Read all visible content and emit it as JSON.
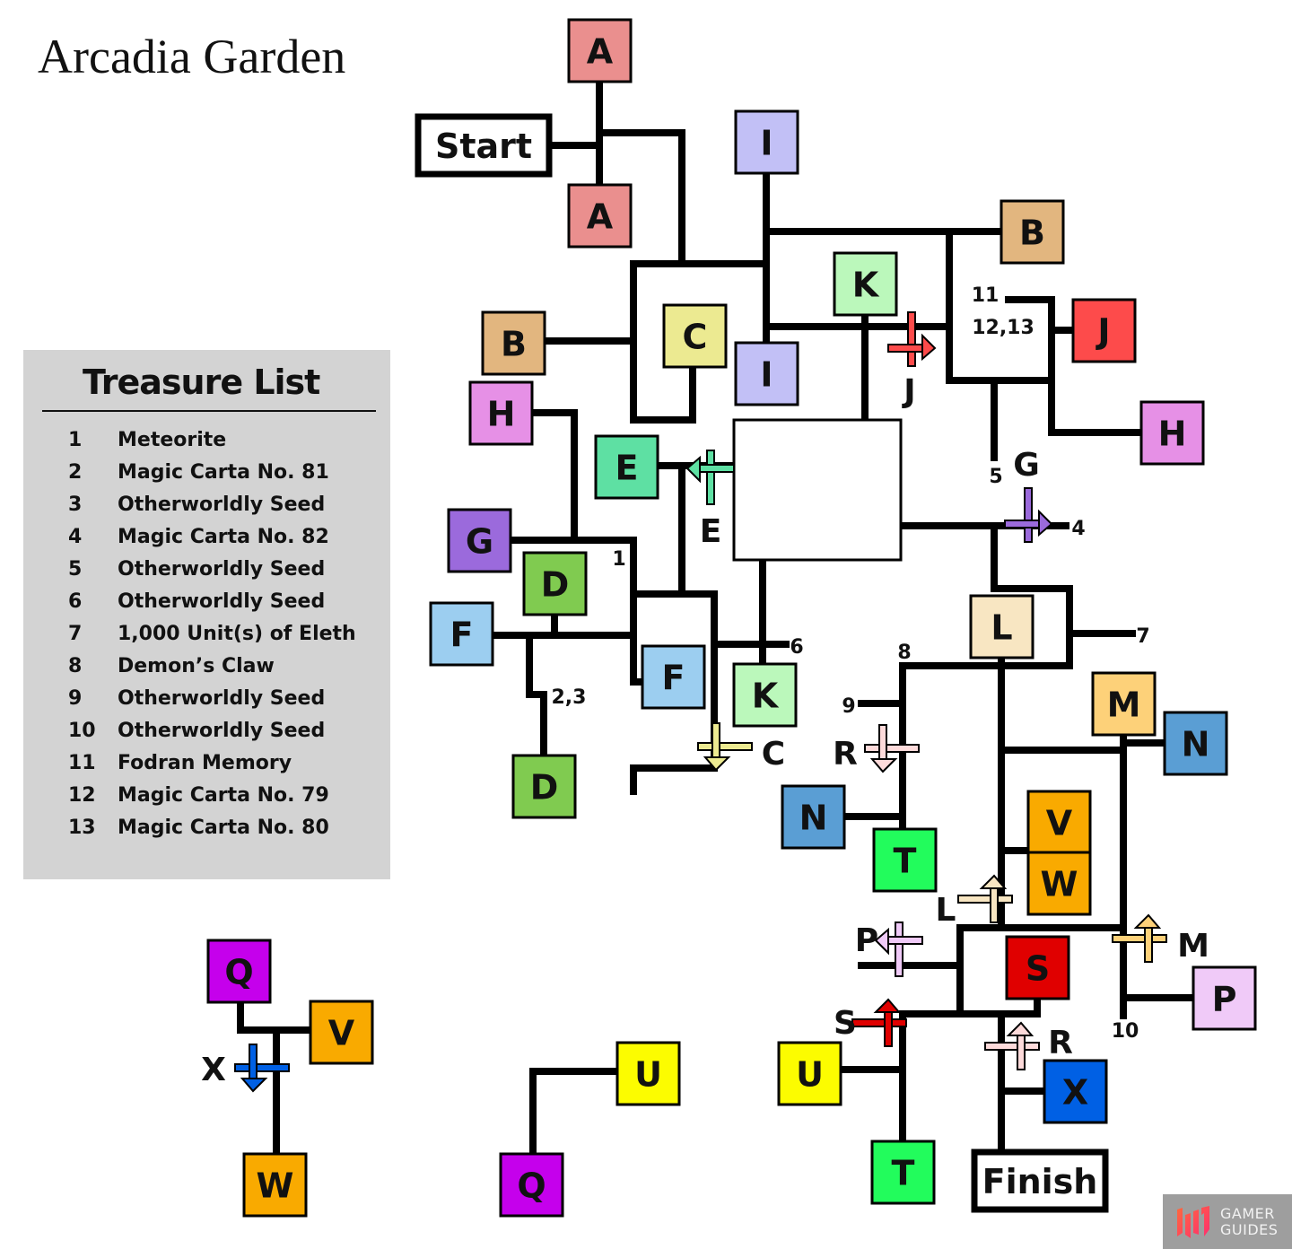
{
  "title": "Arcadia Garden",
  "treasure_list": {
    "heading": "Treasure List",
    "items": [
      {
        "num": "1",
        "name": "Meteorite"
      },
      {
        "num": "2",
        "name": "Magic Carta No. 81"
      },
      {
        "num": "3",
        "name": "Otherworldly Seed"
      },
      {
        "num": "4",
        "name": "Magic Carta No. 82"
      },
      {
        "num": "5",
        "name": "Otherworldly Seed"
      },
      {
        "num": "6",
        "name": "Otherworldly Seed"
      },
      {
        "num": "7",
        "name": "1,000 Unit(s) of Eleth"
      },
      {
        "num": "8",
        "name": "Demon’s Claw"
      },
      {
        "num": "9",
        "name": "Otherworldly Seed"
      },
      {
        "num": "10",
        "name": "Otherworldly Seed"
      },
      {
        "num": "11",
        "name": "Fodran Memory"
      },
      {
        "num": "12",
        "name": "Magic Carta No. 79"
      },
      {
        "num": "13",
        "name": "Magic Carta No. 80"
      }
    ]
  },
  "colors": {
    "A": "#ea8f8e",
    "B": "#e2b67f",
    "C": "#ecea91",
    "D": "#80cb50",
    "E": "#5ee0a3",
    "F": "#9ccef0",
    "G": "#9b6adc",
    "H": "#e690e6",
    "I": "#c2c0f6",
    "J": "#fd4b4b",
    "K": "#bbf8bb",
    "L": "#f8e6c2",
    "M": "#fdd179",
    "N": "#5a9ed4",
    "P": "#f0caf8",
    "Q": "#c500ec",
    "R": "#fddada",
    "S": "#e00000",
    "T": "#22fc5c",
    "U": "#fcfc00",
    "V": "#f9aa00",
    "W": "#f9aa00",
    "X": "#0060e4"
  },
  "endpoints": {
    "start": "Start",
    "finish": "Finish"
  },
  "nodes": [
    "A",
    "A",
    "I",
    "B",
    "K",
    "C",
    "B",
    "I",
    "J",
    "H",
    "H",
    "E",
    "G",
    "D",
    "F",
    "F",
    "K",
    "D",
    "L",
    "M",
    "N",
    "N",
    "V",
    "W",
    "T",
    "S",
    "P",
    "U",
    "T",
    "X",
    "Q",
    "V",
    "W",
    "U",
    "Q"
  ],
  "arrows": [
    {
      "letter": "J",
      "dir": "right"
    },
    {
      "letter": "G",
      "dir": "right"
    },
    {
      "letter": "E",
      "dir": "left"
    },
    {
      "letter": "C",
      "dir": "down"
    },
    {
      "letter": "R",
      "dir": "down"
    },
    {
      "letter": "L",
      "dir": "up"
    },
    {
      "letter": "P",
      "dir": "left"
    },
    {
      "letter": "M",
      "dir": "up"
    },
    {
      "letter": "S",
      "dir": "up"
    },
    {
      "letter": "R",
      "dir": "up"
    },
    {
      "letter": "X",
      "dir": "down"
    }
  ],
  "treasure_markers": [
    "1",
    "2,3",
    "4",
    "5",
    "6",
    "7",
    "8",
    "9",
    "10",
    "11",
    "12,13"
  ],
  "logo": {
    "line1": "GAMER",
    "line2": "GUIDES"
  }
}
